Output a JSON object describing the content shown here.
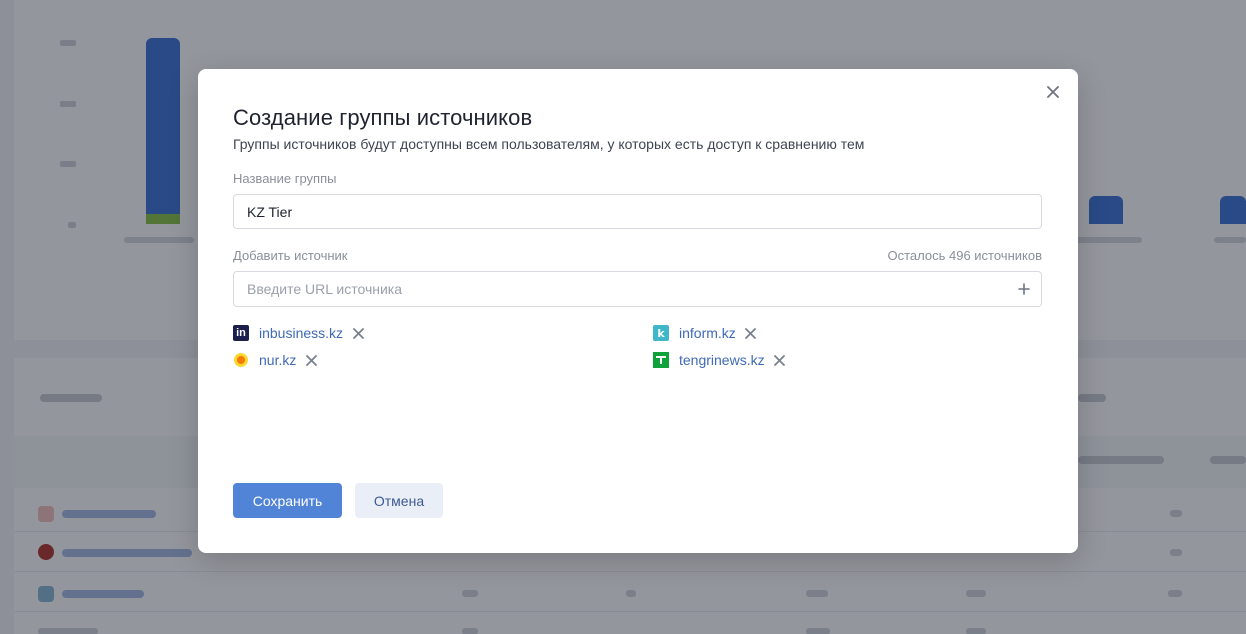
{
  "modal": {
    "title": "Создание группы источников",
    "subtitle": "Группы источников будут доступны всем пользователям, у которых есть доступ к сравнению тем",
    "group_name_label": "Название группы",
    "group_name_value": "KZ Tier",
    "add_source_label": "Добавить источник",
    "remaining_text": "Осталось 496 источников",
    "url_placeholder": "Введите URL источника",
    "sources": [
      {
        "name": "inbusiness.kz",
        "icon": "inbusiness-logo-icon",
        "icon_text": "in",
        "icon_color": "#1a1f4b"
      },
      {
        "name": "inform.kz",
        "icon": "inform-logo-icon",
        "icon_text": "k",
        "icon_color": "#3fb6c9"
      },
      {
        "name": "nur.kz",
        "icon": "nur-logo-icon",
        "icon_text": "",
        "icon_color": "#f7b21b"
      },
      {
        "name": "tengrinews.kz",
        "icon": "tengrinews-logo-icon",
        "icon_text": "",
        "icon_color": "#10a23a"
      }
    ],
    "save_label": "Сохранить",
    "cancel_label": "Отмена"
  },
  "colors": {
    "primary": "#5183d6",
    "link": "#3f69b8",
    "overlay": "rgba(16,22,35,0.45)"
  }
}
